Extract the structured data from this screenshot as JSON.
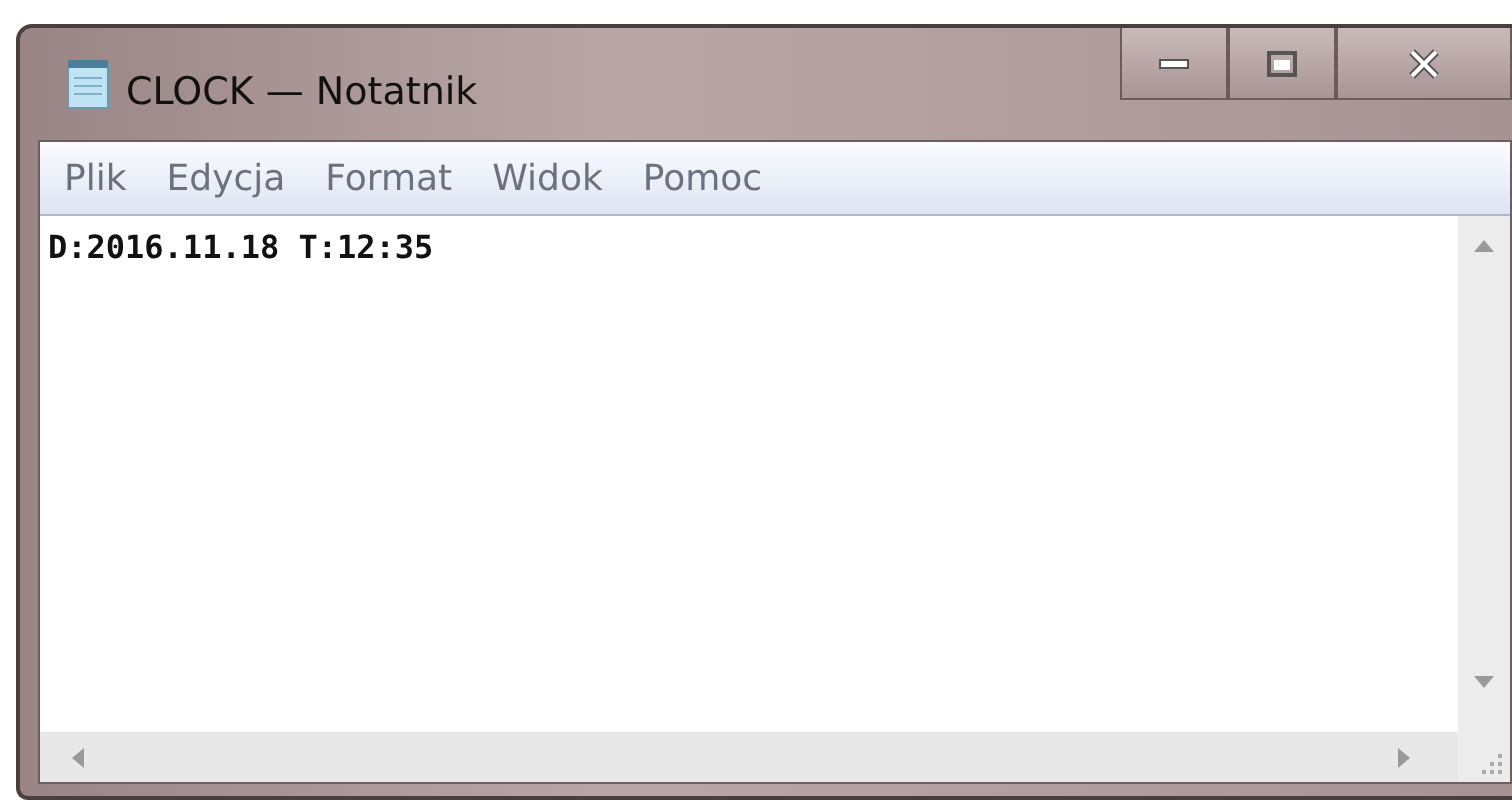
{
  "window": {
    "title": "CLOCK — Notatnik"
  },
  "menu": [
    {
      "label": "Plik"
    },
    {
      "label": "Edycja"
    },
    {
      "label": "Format"
    },
    {
      "label": "Widok"
    },
    {
      "label": "Pomoc"
    }
  ],
  "editor": {
    "text": "D:2016.11.18 T:12:35"
  }
}
